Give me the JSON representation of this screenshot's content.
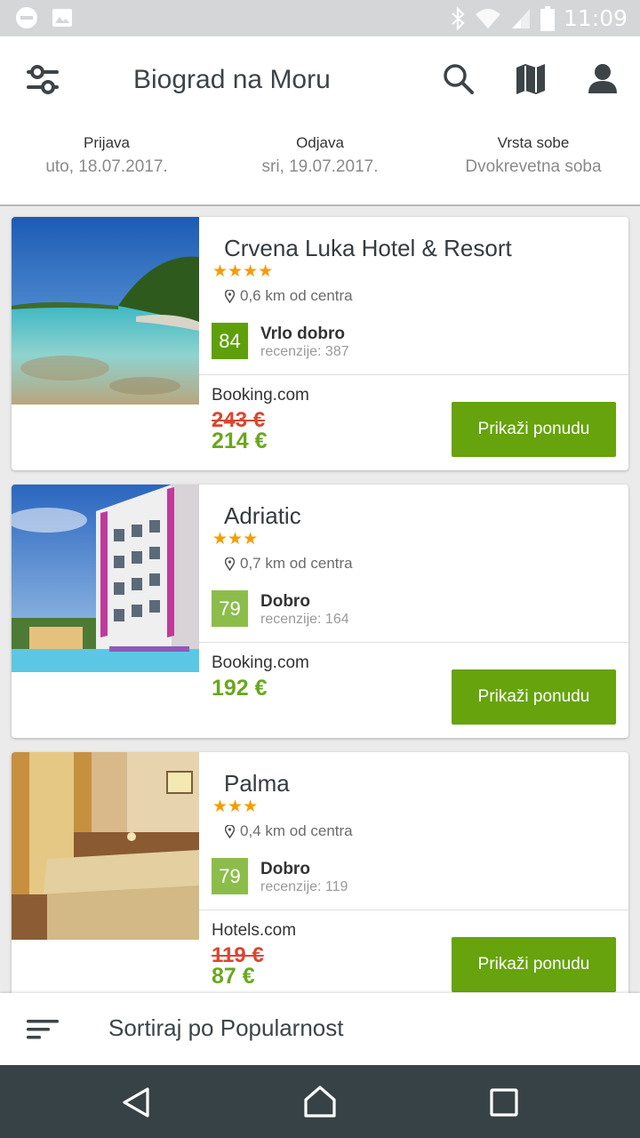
{
  "status_bar": {
    "time": "11:09",
    "icons": [
      "dnd-icon",
      "image-icon",
      "bluetooth-icon",
      "wifi-icon",
      "signal-icon",
      "battery-icon"
    ]
  },
  "header": {
    "title": "Biograd na Moru",
    "icons": [
      "filter-icon",
      "search-icon",
      "map-icon",
      "user-icon"
    ],
    "dates": [
      {
        "label": "Prijava",
        "value": "uto, 18.07.2017."
      },
      {
        "label": "Odjava",
        "value": "sri, 19.07.2017."
      },
      {
        "label": "Vrsta sobe",
        "value": "Dvokrevetna soba"
      }
    ]
  },
  "hotels": [
    {
      "name": "Crvena Luka Hotel & Resort",
      "stars": "★★★★",
      "distance": "0,6 km od centra",
      "score": "84",
      "score_color": "#5ea00a",
      "rating": "Vrlo dobro",
      "reviews": "recenzije: 387",
      "provider": "Booking.com",
      "old_price": "243 €",
      "price": "214 €",
      "button": "Prikaži ponudu"
    },
    {
      "name": "Adriatic",
      "stars": "★★★",
      "distance": "0,7 km od centra",
      "score": "79",
      "score_color": "#8cbd4a",
      "rating": "Dobro",
      "reviews": "recenzije: 164",
      "provider": "Booking.com",
      "old_price": "",
      "price": "192 €",
      "button": "Prikaži ponudu"
    },
    {
      "name": "Palma",
      "stars": "★★★",
      "distance": "0,4 km od centra",
      "score": "79",
      "score_color": "#8cbd4a",
      "rating": "Dobro",
      "reviews": "recenzije: 119",
      "provider": "Hotels.com",
      "old_price": "119 €",
      "price": "87 €",
      "button": "Prikaži ponudu"
    }
  ],
  "sort": {
    "label": "Sortiraj po Popularnost"
  },
  "colors": {
    "accent": "#66a30d",
    "old_price": "#d9472f",
    "stars": "#f59c00",
    "navbar": "#374246"
  }
}
